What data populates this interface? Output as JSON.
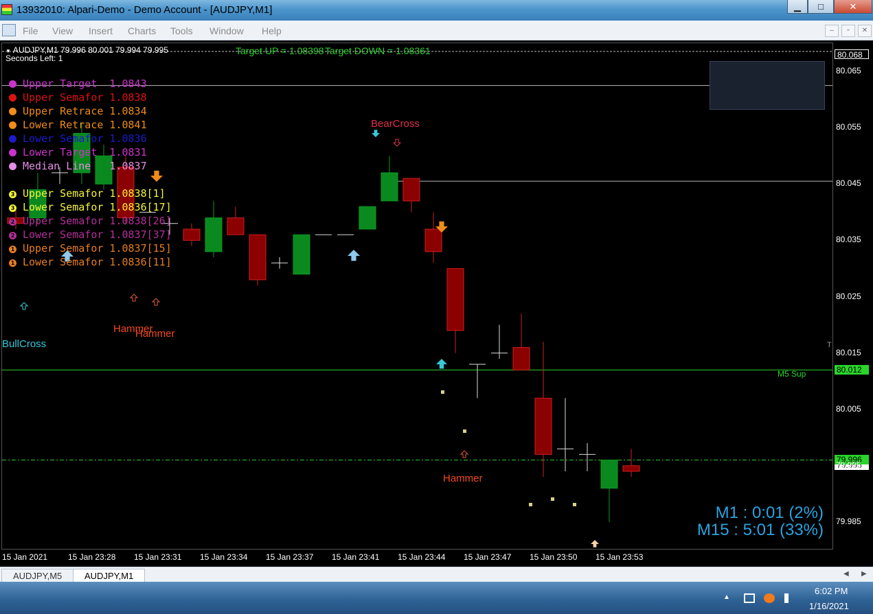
{
  "window": {
    "title": "13932010: Alpari-Demo - Demo Account - [AUDJPY,M1]",
    "minimize_glyph": "▁",
    "maximize_glyph": "□",
    "close_glyph": "✕"
  },
  "menu": {
    "items": [
      "File",
      "View",
      "Insert",
      "Charts",
      "Tools",
      "Window",
      "Help"
    ],
    "mdi_buttons": [
      "–",
      "▫",
      "✕"
    ]
  },
  "chart": {
    "symbol_info": "AUDJPY,M1  79.996 80.001 79.994 79.995",
    "seconds_left": "Seconds Left:  1",
    "target_up": "Target UP = 1.08398",
    "target_down": "Target DOWN = 1.08361",
    "legend_levels": [
      {
        "text": "Upper Target  1.0843",
        "color": "#cc33cc"
      },
      {
        "text": "Upper Semafor 1.0838",
        "color": "#dd1111"
      },
      {
        "text": "Upper Retrace 1.0834",
        "color": "#f08c1a"
      },
      {
        "text": "Lower Retrace 1.0841",
        "color": "#f08c1a"
      },
      {
        "text": "Lower Semafor 1.0836",
        "color": "#1b1bcc"
      },
      {
        "text": "Lower Target  1.0831",
        "color": "#cc33cc"
      },
      {
        "text": "Median Line   1.0837",
        "color": "#e48ee6"
      }
    ],
    "legend_semafors": [
      {
        "num": "3",
        "text": "Upper Semafor 1.0838[1]",
        "color": "#f4f437"
      },
      {
        "num": "3",
        "text": "Lower Semafor 1.0836[17]",
        "color": "#f4f437"
      },
      {
        "num": "2",
        "text": "Upper Semafor 1.0838[26]",
        "color": "#b52f9a"
      },
      {
        "num": "2",
        "text": "Lower Semafor 1.0837[37]",
        "color": "#b52f9a"
      },
      {
        "num": "1",
        "text": "Upper Semafor 1.0837[15]",
        "color": "#e67e22"
      },
      {
        "num": "1",
        "text": "Lower Semafor 1.0836[11]",
        "color": "#e67e22"
      }
    ],
    "labels": {
      "bear_cross": "BearCross",
      "bull_cross": "BullCross",
      "hammer_1": "Hammer",
      "hammer_2": "Hammer",
      "hammer_3": "Hammer",
      "m5_sup": "M5 Sup",
      "t_marker": "T"
    },
    "timer_m1": "M1 : 0:01 (2%)",
    "timer_m15": "M15 : 5:01 (33%)",
    "colors": {
      "bull": "#0a8a1e",
      "bear": "#8b0000",
      "bear_wick": "#cc1f1f",
      "sup_line": "#2ad42a",
      "current_price_line": "#2ad42a"
    }
  },
  "price_axis": {
    "labels": [
      "80.065",
      "80.055",
      "80.045",
      "80.035",
      "80.025",
      "80.015",
      "80.005",
      "79.995",
      "79.985"
    ],
    "top_tag": "80.068",
    "sup_tag": "80.012",
    "current_tag": "79.996",
    "bid_tag": "79.995"
  },
  "time_axis": {
    "labels": [
      "15 Jan 2021",
      "15 Jan 23:28",
      "15 Jan 23:31",
      "15 Jan 23:34",
      "15 Jan 23:37",
      "15 Jan 23:41",
      "15 Jan 23:44",
      "15 Jan 23:47",
      "15 Jan 23:50",
      "15 Jan 23:53"
    ]
  },
  "tabs": [
    "AUDJPY,M5",
    "AUDJPY,M1"
  ],
  "taskbar": {
    "time": "6:02 PM",
    "date": "1/16/2021"
  },
  "chart_data": {
    "type": "candlestick",
    "symbol": "AUDJPY",
    "timeframe": "M1",
    "ylim": [
      79.98,
      80.07
    ],
    "x": [
      "23:25",
      "23:26",
      "23:27",
      "23:28",
      "23:29",
      "23:30",
      "23:31",
      "23:32",
      "23:33",
      "23:34",
      "23:35",
      "23:36",
      "23:37",
      "23:38",
      "23:39",
      "23:40",
      "23:41",
      "23:42",
      "23:43",
      "23:44",
      "23:45",
      "23:46",
      "23:47",
      "23:48",
      "23:49",
      "23:50",
      "23:51",
      "23:52",
      "23:53",
      "23:54"
    ],
    "ohlc": [
      [
        80.039,
        80.041,
        80.037,
        80.038
      ],
      [
        80.039,
        80.047,
        80.038,
        80.044
      ],
      [
        80.047,
        80.048,
        80.045,
        80.047
      ],
      [
        80.047,
        80.056,
        80.045,
        80.054
      ],
      [
        80.045,
        80.052,
        80.044,
        80.05
      ],
      [
        80.048,
        80.05,
        80.038,
        80.039
      ],
      [
        80.04,
        80.04,
        80.04,
        80.04
      ],
      [
        80.038,
        80.039,
        80.036,
        80.038
      ],
      [
        80.037,
        80.038,
        80.034,
        80.035
      ],
      [
        80.033,
        80.042,
        80.032,
        80.039
      ],
      [
        80.039,
        80.041,
        80.036,
        80.036
      ],
      [
        80.036,
        80.036,
        80.027,
        80.028
      ],
      [
        80.031,
        80.032,
        80.03,
        80.031
      ],
      [
        80.029,
        80.036,
        80.029,
        80.036
      ],
      [
        80.036,
        80.036,
        80.036,
        80.036
      ],
      [
        80.036,
        80.036,
        80.036,
        80.036
      ],
      [
        80.037,
        80.041,
        80.037,
        80.041
      ],
      [
        80.042,
        80.05,
        80.042,
        80.047
      ],
      [
        80.046,
        80.046,
        80.04,
        80.042
      ],
      [
        80.037,
        80.04,
        80.031,
        80.033
      ],
      [
        80.03,
        80.03,
        80.015,
        80.019
      ],
      [
        80.013,
        80.013,
        80.007,
        80.013
      ],
      [
        80.015,
        80.02,
        80.014,
        80.015
      ],
      [
        80.016,
        80.022,
        80.012,
        80.012
      ],
      [
        80.007,
        80.017,
        79.993,
        79.997
      ],
      [
        79.998,
        80.007,
        79.994,
        79.998
      ],
      [
        79.997,
        79.999,
        79.994,
        79.997
      ],
      [
        79.991,
        79.996,
        79.985,
        79.996
      ],
      [
        79.995,
        79.998,
        79.993,
        79.994
      ]
    ],
    "horizontal_lines": [
      {
        "name": "Target UP",
        "value": 1.08398
      },
      {
        "name": "Target DOWN",
        "value": 1.08361
      },
      {
        "name": "M5 Sup",
        "value": 80.012
      },
      {
        "name": "current",
        "value": 79.996
      }
    ]
  }
}
